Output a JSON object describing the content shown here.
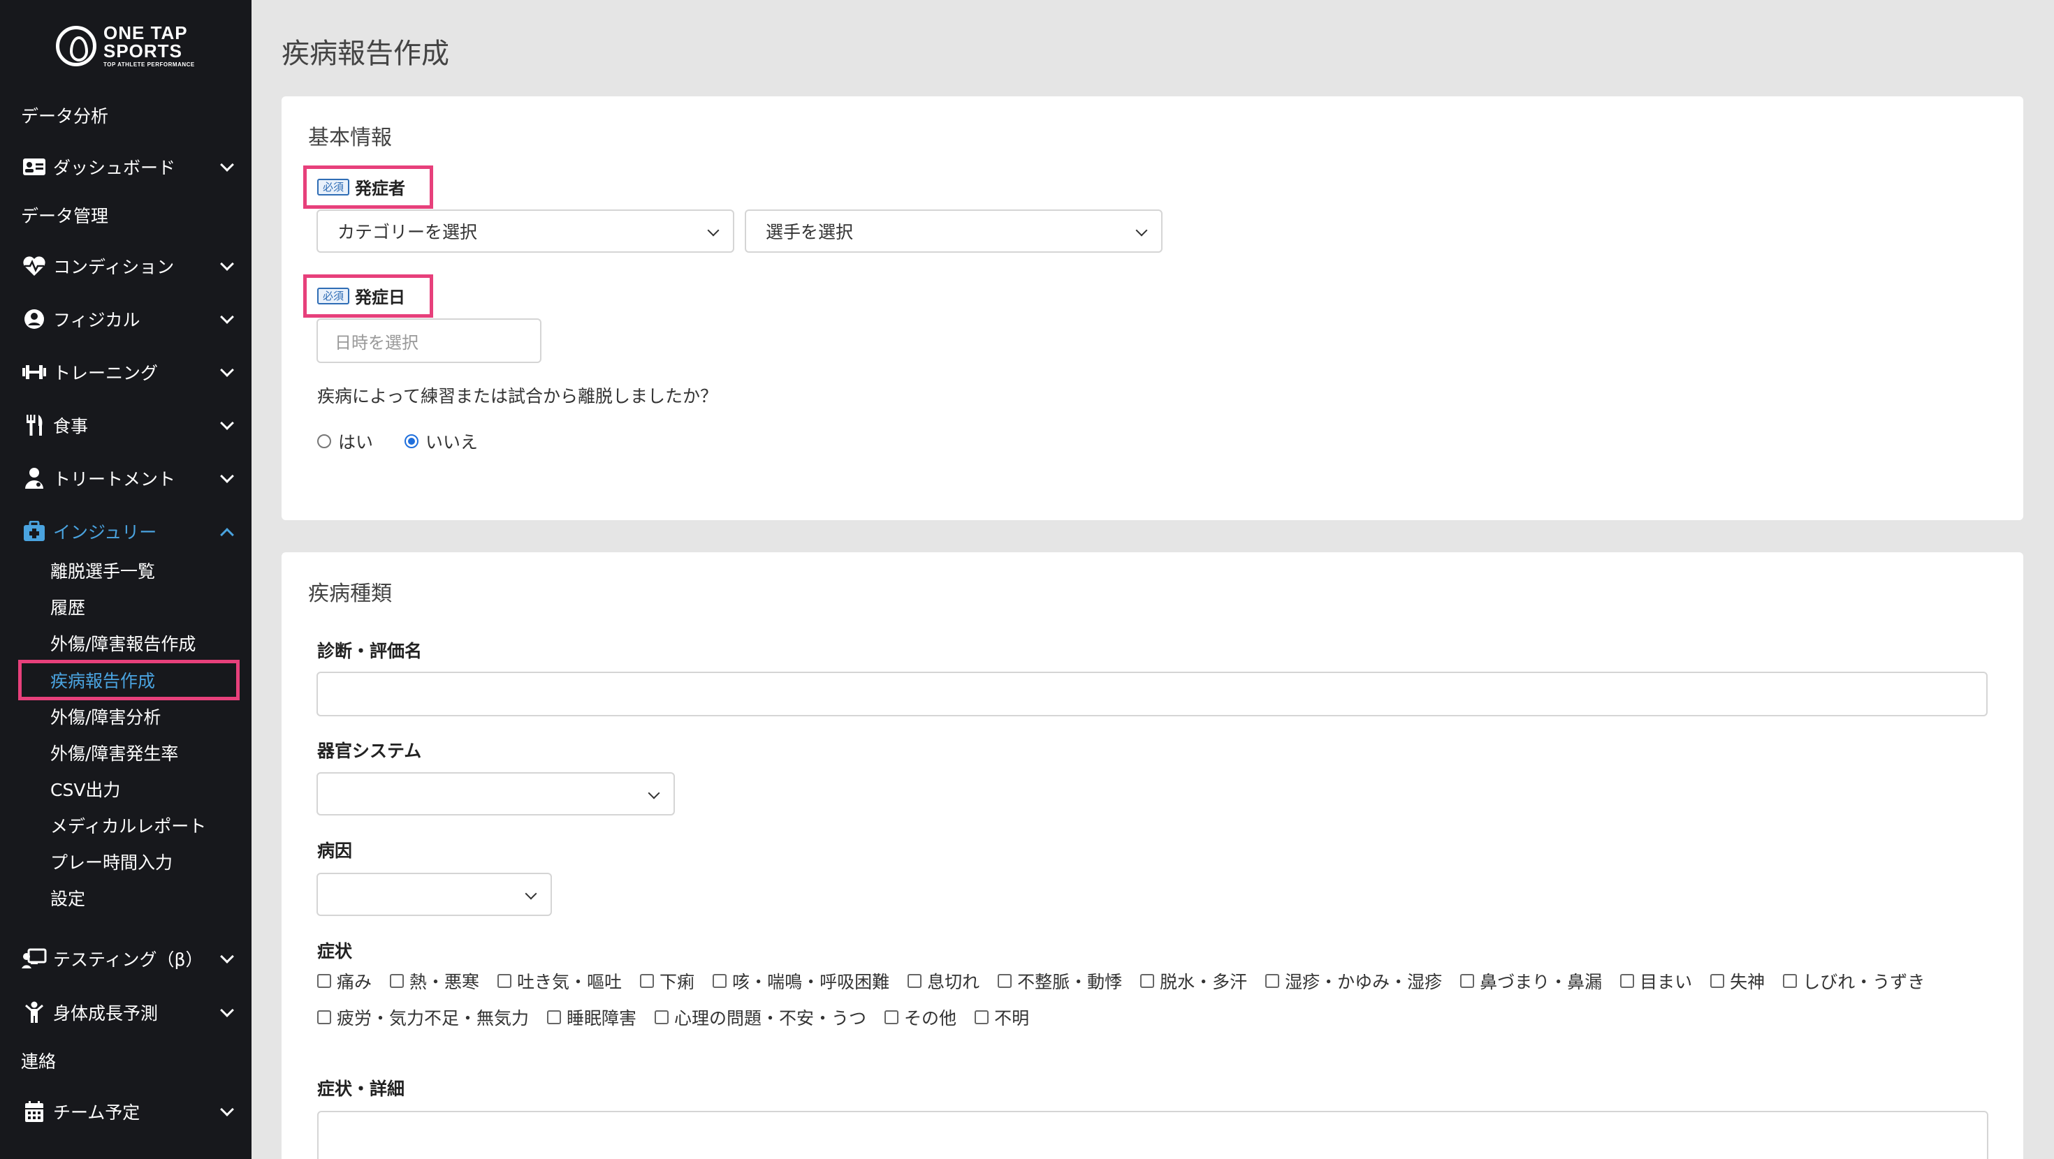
{
  "brand": {
    "line1": "ONE TAP",
    "line2": "SPORTS",
    "line3": "TOP ATHLETE PERFORMANCE"
  },
  "sidebar": {
    "items": [
      {
        "label": "データ分析"
      },
      {
        "label": "ダッシュボード",
        "icon": "id-card-icon"
      },
      {
        "label": "データ管理"
      },
      {
        "label": "コンディション",
        "icon": "heart-pulse-icon"
      },
      {
        "label": "フィジカル",
        "icon": "user-circle-icon"
      },
      {
        "label": "トレーニング",
        "icon": "dumbbell-icon"
      },
      {
        "label": "食事",
        "icon": "utensils-icon"
      },
      {
        "label": "トリートメント",
        "icon": "user-doctor-icon"
      },
      {
        "label": "インジュリー",
        "icon": "medkit-icon"
      },
      {
        "label": "テスティング（β）",
        "icon": "chalkboard-icon"
      },
      {
        "label": "身体成長予測",
        "icon": "child-icon"
      },
      {
        "label": "連絡"
      },
      {
        "label": "チーム予定",
        "icon": "calendar-icon"
      }
    ],
    "injury_sub": [
      {
        "label": "離脱選手一覧"
      },
      {
        "label": "履歴"
      },
      {
        "label": "外傷/障害報告作成"
      },
      {
        "label": "疾病報告作成"
      },
      {
        "label": "外傷/障害分析"
      },
      {
        "label": "外傷/障害発生率"
      },
      {
        "label": "CSV出力"
      },
      {
        "label": "メディカルレポート"
      },
      {
        "label": "プレー時間入力"
      },
      {
        "label": "設定"
      }
    ]
  },
  "page": {
    "title": "疾病報告作成"
  },
  "basic": {
    "title": "基本情報",
    "required_badge": "必須",
    "onset_person_label": "発症者",
    "category_select": "カテゴリーを選択",
    "player_select": "選手を選択",
    "onset_date_label": "発症日",
    "date_placeholder": "日時を選択",
    "question": "疾病によって練習または試合から離脱しましたか？",
    "radio_yes": "はい",
    "radio_no": "いいえ",
    "radio_selected": "いいえ"
  },
  "disease": {
    "title": "疾病種類",
    "diagnosis_label": "診断・評価名",
    "diagnosis_value": "",
    "organ_label": "器官システム",
    "organ_value": "",
    "cause_label": "病因",
    "cause_value": "",
    "symptoms_label": "症状",
    "symptoms": [
      "痛み",
      "熱・悪寒",
      "吐き気・嘔吐",
      "下痢",
      "咳・喘鳴・呼吸困難",
      "息切れ",
      "不整脈・動悸",
      "脱水・多汗",
      "湿疹・かゆみ・湿疹",
      "鼻づまり・鼻漏",
      "目まい",
      "失神",
      "しびれ・うずき",
      "疲労・気力不足・無気力",
      "睡眠障害",
      "心理の問題・不安・うつ",
      "その他",
      "不明"
    ],
    "details_label": "症状・詳細"
  },
  "colors": {
    "sidebar_bg": "#17181c",
    "accent_blue": "#4aa3df",
    "highlight_pink": "#e7407b",
    "page_bg": "#e5e5e5"
  }
}
